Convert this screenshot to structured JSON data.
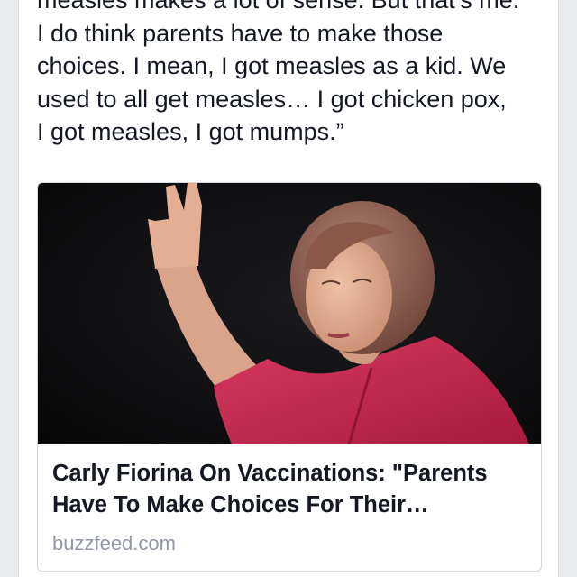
{
  "post": {
    "text_lines": [
      "measles makes a lot of sense. But that’s me.",
      "I do think parents have to make those",
      "choices. I mean, I got measles as a kid. We",
      "used to all get measles… I got chicken pox,",
      "I got measles, I got mumps.”"
    ]
  },
  "link": {
    "image_alt": "Photo of a woman with short reddish-brown hair in a red jacket, raising her right hand against a dark background",
    "title_lines": [
      "Carly Fiorina On Vaccinations: \"Parents",
      "Have To Make Choices For Their…"
    ],
    "domain": "buzzfeed.com"
  },
  "colors": {
    "page_bg": "#e9eaed",
    "card_bg": "#ffffff",
    "text": "#141823",
    "domain_text": "#9197a3",
    "jacket": "#c8294f"
  }
}
